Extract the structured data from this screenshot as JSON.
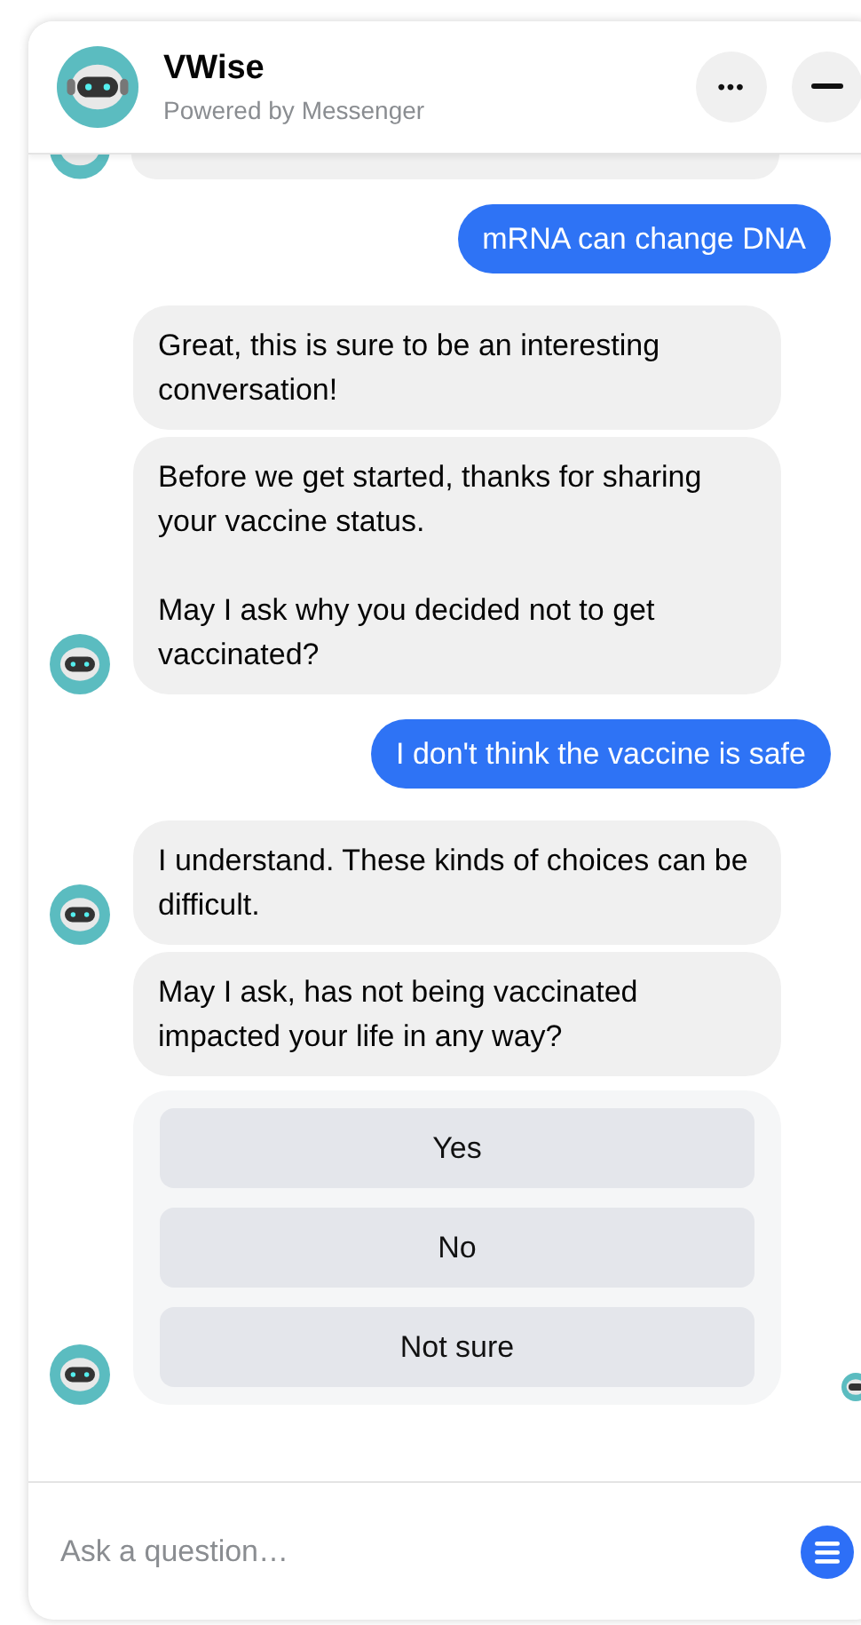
{
  "header": {
    "title": "VWise",
    "subtitle": "Powered by Messenger",
    "more_icon": "•••"
  },
  "messages": [
    {
      "kind": "bot_stub"
    },
    {
      "kind": "user",
      "paragraphs": [
        "mRNA can change DNA"
      ]
    },
    {
      "kind": "bot",
      "avatar": false,
      "paragraphs": [
        "Great, this is sure to be an interesting conversation!"
      ]
    },
    {
      "kind": "bot",
      "avatar": true,
      "paragraphs": [
        "Before we get started, thanks for sharing your vaccine status.",
        "May I ask why you decided not to get vaccinated?"
      ]
    },
    {
      "kind": "user",
      "paragraphs": [
        "I don't think the vaccine is safe"
      ]
    },
    {
      "kind": "bot",
      "avatar": true,
      "paragraphs": [
        "I understand. These kinds of choices can be difficult."
      ]
    },
    {
      "kind": "bot",
      "avatar": false,
      "paragraphs": [
        "May I ask, has not being vaccinated impacted your life in any way?"
      ]
    },
    {
      "kind": "choices",
      "avatar": true,
      "options": [
        "Yes",
        "No",
        "Not sure"
      ]
    }
  ],
  "composer": {
    "placeholder": "Ask a question…"
  }
}
